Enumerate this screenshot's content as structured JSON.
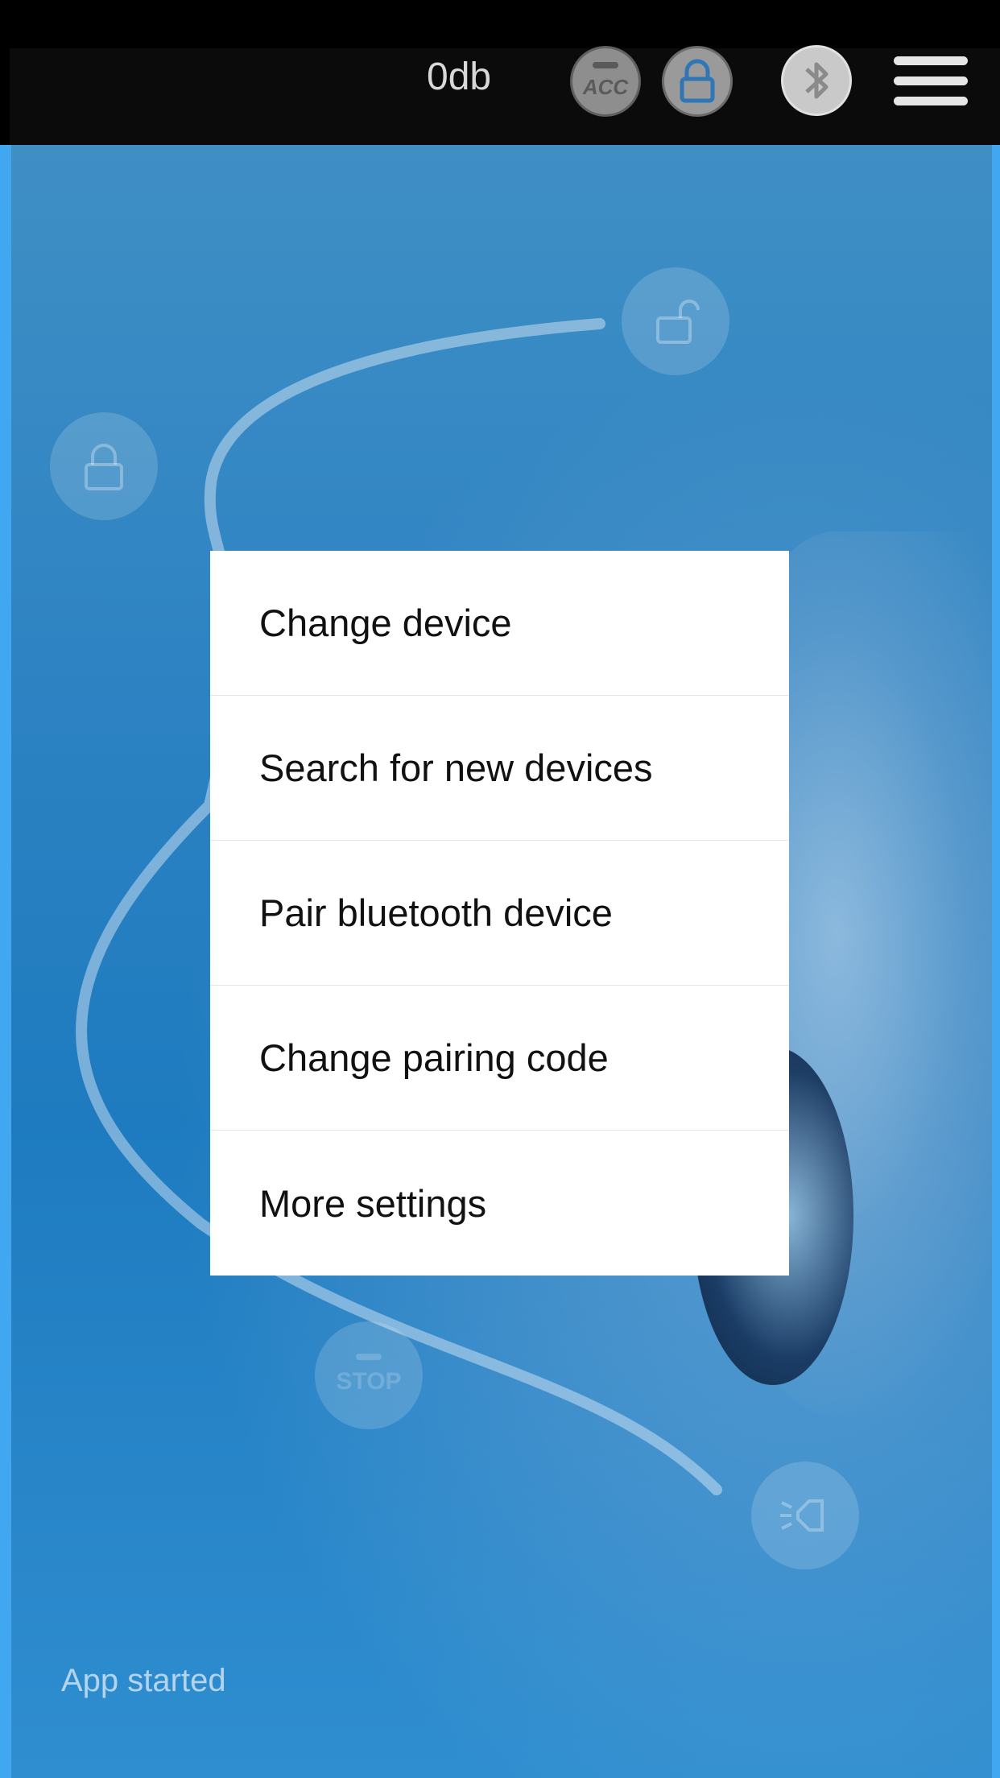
{
  "topbar": {
    "volume_label": "0db",
    "acc_icon": "acc-icon",
    "acc_text": "ACC",
    "lock_icon": "lock-icon",
    "bluetooth_icon": "bluetooth-icon",
    "menu_icon": "hamburger-menu-icon"
  },
  "background": {
    "unlock_icon": "unlock-icon",
    "lock_icon": "lock-icon",
    "stop_icon": "stop-icon",
    "stop_text": "STOP",
    "horn_icon": "horn-icon"
  },
  "menu": {
    "items": [
      {
        "label": "Change device"
      },
      {
        "label": "Search for new devices"
      },
      {
        "label": "Pair bluetooth device"
      },
      {
        "label": "Change pairing code"
      },
      {
        "label": "More settings"
      }
    ]
  },
  "status": {
    "text": "App started"
  },
  "colors": {
    "background_blue": "#2c82c2",
    "edge_blue": "#41a7f0",
    "popup_bg": "#ffffff",
    "topbar_bg": "#0b0b0b"
  }
}
